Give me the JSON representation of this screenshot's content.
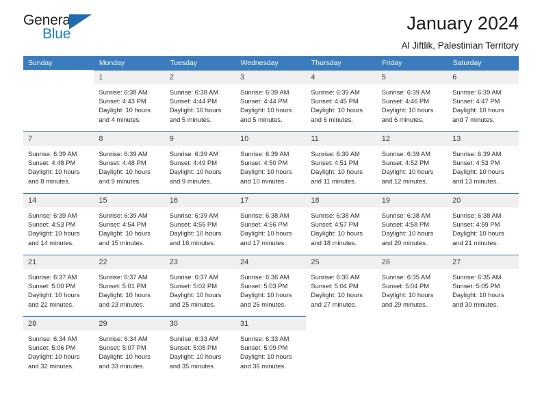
{
  "brand": {
    "name_top": "General",
    "name_bottom": "Blue",
    "triangle_color": "#1f6cb0",
    "blue_color": "#1f7bc1"
  },
  "header": {
    "title": "January 2024",
    "subtitle": "Al Jiftlik, Palestinian Territory",
    "header_bg": "#3a7cbe",
    "daynum_bg": "#f0f0f0",
    "row_rule_color": "#2e6da4"
  },
  "weekdays": [
    "Sunday",
    "Monday",
    "Tuesday",
    "Wednesday",
    "Thursday",
    "Friday",
    "Saturday"
  ],
  "weeks": [
    [
      {
        "day": ""
      },
      {
        "day": "1",
        "sunrise": "Sunrise: 6:38 AM",
        "sunset": "Sunset: 4:43 PM",
        "daylight_1": "Daylight: 10 hours",
        "daylight_2": "and 4 minutes."
      },
      {
        "day": "2",
        "sunrise": "Sunrise: 6:38 AM",
        "sunset": "Sunset: 4:44 PM",
        "daylight_1": "Daylight: 10 hours",
        "daylight_2": "and 5 minutes."
      },
      {
        "day": "3",
        "sunrise": "Sunrise: 6:39 AM",
        "sunset": "Sunset: 4:44 PM",
        "daylight_1": "Daylight: 10 hours",
        "daylight_2": "and 5 minutes."
      },
      {
        "day": "4",
        "sunrise": "Sunrise: 6:39 AM",
        "sunset": "Sunset: 4:45 PM",
        "daylight_1": "Daylight: 10 hours",
        "daylight_2": "and 6 minutes."
      },
      {
        "day": "5",
        "sunrise": "Sunrise: 6:39 AM",
        "sunset": "Sunset: 4:46 PM",
        "daylight_1": "Daylight: 10 hours",
        "daylight_2": "and 6 minutes."
      },
      {
        "day": "6",
        "sunrise": "Sunrise: 6:39 AM",
        "sunset": "Sunset: 4:47 PM",
        "daylight_1": "Daylight: 10 hours",
        "daylight_2": "and 7 minutes."
      }
    ],
    [
      {
        "day": "7",
        "sunrise": "Sunrise: 6:39 AM",
        "sunset": "Sunset: 4:48 PM",
        "daylight_1": "Daylight: 10 hours",
        "daylight_2": "and 8 minutes."
      },
      {
        "day": "8",
        "sunrise": "Sunrise: 6:39 AM",
        "sunset": "Sunset: 4:48 PM",
        "daylight_1": "Daylight: 10 hours",
        "daylight_2": "and 9 minutes."
      },
      {
        "day": "9",
        "sunrise": "Sunrise: 6:39 AM",
        "sunset": "Sunset: 4:49 PM",
        "daylight_1": "Daylight: 10 hours",
        "daylight_2": "and 9 minutes."
      },
      {
        "day": "10",
        "sunrise": "Sunrise: 6:39 AM",
        "sunset": "Sunset: 4:50 PM",
        "daylight_1": "Daylight: 10 hours",
        "daylight_2": "and 10 minutes."
      },
      {
        "day": "11",
        "sunrise": "Sunrise: 6:39 AM",
        "sunset": "Sunset: 4:51 PM",
        "daylight_1": "Daylight: 10 hours",
        "daylight_2": "and 11 minutes."
      },
      {
        "day": "12",
        "sunrise": "Sunrise: 6:39 AM",
        "sunset": "Sunset: 4:52 PM",
        "daylight_1": "Daylight: 10 hours",
        "daylight_2": "and 12 minutes."
      },
      {
        "day": "13",
        "sunrise": "Sunrise: 6:39 AM",
        "sunset": "Sunset: 4:53 PM",
        "daylight_1": "Daylight: 10 hours",
        "daylight_2": "and 13 minutes."
      }
    ],
    [
      {
        "day": "14",
        "sunrise": "Sunrise: 6:39 AM",
        "sunset": "Sunset: 4:53 PM",
        "daylight_1": "Daylight: 10 hours",
        "daylight_2": "and 14 minutes."
      },
      {
        "day": "15",
        "sunrise": "Sunrise: 6:39 AM",
        "sunset": "Sunset: 4:54 PM",
        "daylight_1": "Daylight: 10 hours",
        "daylight_2": "and 15 minutes."
      },
      {
        "day": "16",
        "sunrise": "Sunrise: 6:39 AM",
        "sunset": "Sunset: 4:55 PM",
        "daylight_1": "Daylight: 10 hours",
        "daylight_2": "and 16 minutes."
      },
      {
        "day": "17",
        "sunrise": "Sunrise: 6:38 AM",
        "sunset": "Sunset: 4:56 PM",
        "daylight_1": "Daylight: 10 hours",
        "daylight_2": "and 17 minutes."
      },
      {
        "day": "18",
        "sunrise": "Sunrise: 6:38 AM",
        "sunset": "Sunset: 4:57 PM",
        "daylight_1": "Daylight: 10 hours",
        "daylight_2": "and 18 minutes."
      },
      {
        "day": "19",
        "sunrise": "Sunrise: 6:38 AM",
        "sunset": "Sunset: 4:58 PM",
        "daylight_1": "Daylight: 10 hours",
        "daylight_2": "and 20 minutes."
      },
      {
        "day": "20",
        "sunrise": "Sunrise: 6:38 AM",
        "sunset": "Sunset: 4:59 PM",
        "daylight_1": "Daylight: 10 hours",
        "daylight_2": "and 21 minutes."
      }
    ],
    [
      {
        "day": "21",
        "sunrise": "Sunrise: 6:37 AM",
        "sunset": "Sunset: 5:00 PM",
        "daylight_1": "Daylight: 10 hours",
        "daylight_2": "and 22 minutes."
      },
      {
        "day": "22",
        "sunrise": "Sunrise: 6:37 AM",
        "sunset": "Sunset: 5:01 PM",
        "daylight_1": "Daylight: 10 hours",
        "daylight_2": "and 23 minutes."
      },
      {
        "day": "23",
        "sunrise": "Sunrise: 6:37 AM",
        "sunset": "Sunset: 5:02 PM",
        "daylight_1": "Daylight: 10 hours",
        "daylight_2": "and 25 minutes."
      },
      {
        "day": "24",
        "sunrise": "Sunrise: 6:36 AM",
        "sunset": "Sunset: 5:03 PM",
        "daylight_1": "Daylight: 10 hours",
        "daylight_2": "and 26 minutes."
      },
      {
        "day": "25",
        "sunrise": "Sunrise: 6:36 AM",
        "sunset": "Sunset: 5:04 PM",
        "daylight_1": "Daylight: 10 hours",
        "daylight_2": "and 27 minutes."
      },
      {
        "day": "26",
        "sunrise": "Sunrise: 6:35 AM",
        "sunset": "Sunset: 5:04 PM",
        "daylight_1": "Daylight: 10 hours",
        "daylight_2": "and 29 minutes."
      },
      {
        "day": "27",
        "sunrise": "Sunrise: 6:35 AM",
        "sunset": "Sunset: 5:05 PM",
        "daylight_1": "Daylight: 10 hours",
        "daylight_2": "and 30 minutes."
      }
    ],
    [
      {
        "day": "28",
        "sunrise": "Sunrise: 6:34 AM",
        "sunset": "Sunset: 5:06 PM",
        "daylight_1": "Daylight: 10 hours",
        "daylight_2": "and 32 minutes."
      },
      {
        "day": "29",
        "sunrise": "Sunrise: 6:34 AM",
        "sunset": "Sunset: 5:07 PM",
        "daylight_1": "Daylight: 10 hours",
        "daylight_2": "and 33 minutes."
      },
      {
        "day": "30",
        "sunrise": "Sunrise: 6:33 AM",
        "sunset": "Sunset: 5:08 PM",
        "daylight_1": "Daylight: 10 hours",
        "daylight_2": "and 35 minutes."
      },
      {
        "day": "31",
        "sunrise": "Sunrise: 6:33 AM",
        "sunset": "Sunset: 5:09 PM",
        "daylight_1": "Daylight: 10 hours",
        "daylight_2": "and 36 minutes."
      },
      {
        "day": ""
      },
      {
        "day": ""
      },
      {
        "day": ""
      }
    ]
  ]
}
